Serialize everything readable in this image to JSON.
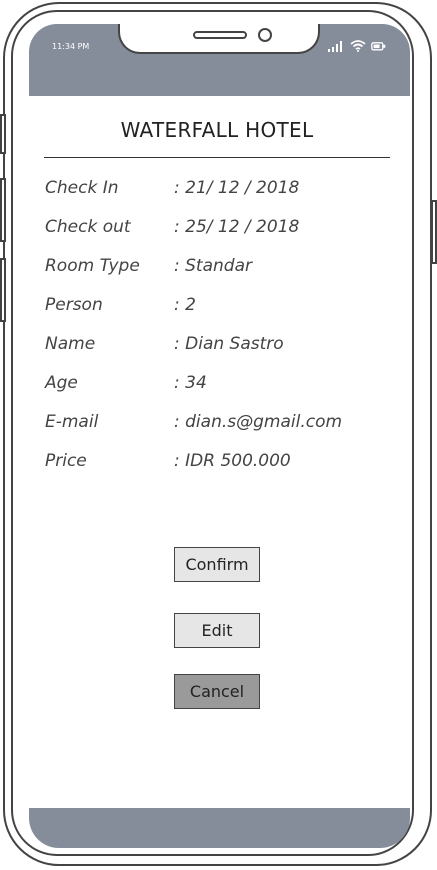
{
  "status_bar": {
    "time": "11:34 PM",
    "icons": [
      "signal-icon",
      "wifi-icon",
      "battery-icon"
    ]
  },
  "hotel": {
    "title": "WATERFALL HOTEL"
  },
  "details": [
    {
      "label": "Check In",
      "value": ": 21/ 12 / 2018"
    },
    {
      "label": "Check out",
      "value": ": 25/ 12 / 2018"
    },
    {
      "label": "Room Type",
      "value": ": Standar"
    },
    {
      "label": "Person",
      "value": ": 2"
    },
    {
      "label": "Name",
      "value": ": Dian Sastro"
    },
    {
      "label": "Age",
      "value": ": 34"
    },
    {
      "label": "E-mail",
      "value": ": dian.s@gmail.com"
    },
    {
      "label": "Price",
      "value": ": IDR 500.000"
    }
  ],
  "actions": {
    "confirm_label": "Confirm",
    "edit_label": "Edit",
    "cancel_label": "Cancel"
  },
  "colors": {
    "frame_bar": "#858c9a",
    "button_light": "#e6e6e6",
    "button_dark": "#9a9a9a"
  }
}
